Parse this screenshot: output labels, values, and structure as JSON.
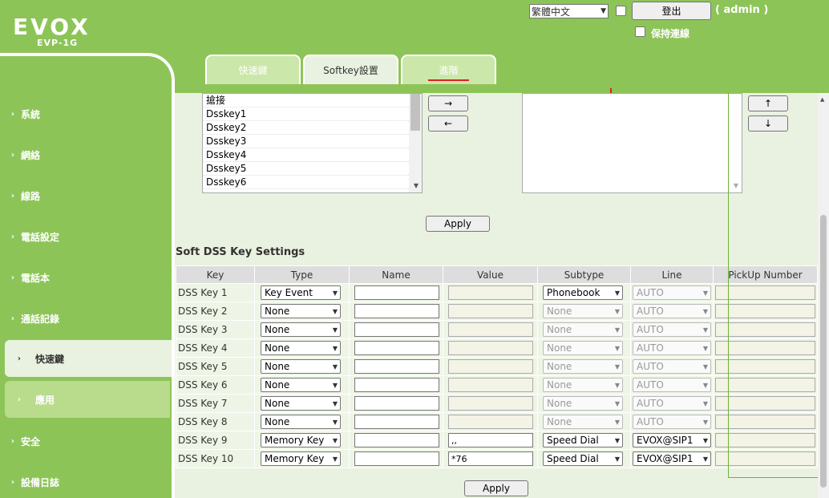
{
  "header": {
    "brand": "EVOX",
    "model": "EVP-1G",
    "language": "繁體中文",
    "logout_label": "登出",
    "user_label": "( admin )",
    "keep_connection_label": "保持連線"
  },
  "sidebar": {
    "items": [
      {
        "label": "系統"
      },
      {
        "label": "網絡"
      },
      {
        "label": "線路"
      },
      {
        "label": "電話設定"
      },
      {
        "label": "電話本"
      },
      {
        "label": "通話記錄"
      },
      {
        "label": "快速鍵"
      },
      {
        "label": "應用"
      },
      {
        "label": "安全"
      },
      {
        "label": "設備日誌"
      }
    ]
  },
  "tabs": [
    {
      "label": "快速鍵"
    },
    {
      "label": "Softkey設置"
    },
    {
      "label": "進階"
    }
  ],
  "softkey_list": {
    "items": [
      "搶接",
      "Dsskey1",
      "Dsskey2",
      "Dsskey3",
      "Dsskey4",
      "Dsskey5",
      "Dsskey6"
    ],
    "move_right_label": "→",
    "move_left_label": "←",
    "move_up_label": "↑",
    "move_down_label": "↓",
    "apply_label": "Apply"
  },
  "dss": {
    "section_title": "Soft DSS Key Settings",
    "columns": [
      "Key",
      "Type",
      "Name",
      "Value",
      "Subtype",
      "Line",
      "PickUp Number"
    ],
    "rows": [
      {
        "key": "DSS Key 1",
        "type": "Key Event",
        "name": "",
        "value": "",
        "subtype": "Phonebook",
        "line": "AUTO",
        "pickup": ""
      },
      {
        "key": "DSS Key 2",
        "type": "None",
        "name": "",
        "value": "",
        "subtype": "None",
        "line": "AUTO",
        "pickup": ""
      },
      {
        "key": "DSS Key 3",
        "type": "None",
        "name": "",
        "value": "",
        "subtype": "None",
        "line": "AUTO",
        "pickup": ""
      },
      {
        "key": "DSS Key 4",
        "type": "None",
        "name": "",
        "value": "",
        "subtype": "None",
        "line": "AUTO",
        "pickup": ""
      },
      {
        "key": "DSS Key 5",
        "type": "None",
        "name": "",
        "value": "",
        "subtype": "None",
        "line": "AUTO",
        "pickup": ""
      },
      {
        "key": "DSS Key 6",
        "type": "None",
        "name": "",
        "value": "",
        "subtype": "None",
        "line": "AUTO",
        "pickup": ""
      },
      {
        "key": "DSS Key 7",
        "type": "None",
        "name": "",
        "value": "",
        "subtype": "None",
        "line": "AUTO",
        "pickup": ""
      },
      {
        "key": "DSS Key 8",
        "type": "None",
        "name": "",
        "value": "",
        "subtype": "None",
        "line": "AUTO",
        "pickup": ""
      },
      {
        "key": "DSS Key 9",
        "type": "Memory Key",
        "name": "",
        "value": ",,",
        "subtype": "Speed Dial",
        "line": "EVOX@SIP1",
        "pickup": ""
      },
      {
        "key": "DSS Key 10",
        "type": "Memory Key",
        "name": "",
        "value": "*76",
        "subtype": "Speed Dial",
        "line": "EVOX@SIP1",
        "pickup": ""
      }
    ],
    "apply_label": "Apply"
  },
  "colors": {
    "brand_green": "#8dc458",
    "content_bg": "#e9f2e0",
    "tab_marker": "#e02020"
  }
}
